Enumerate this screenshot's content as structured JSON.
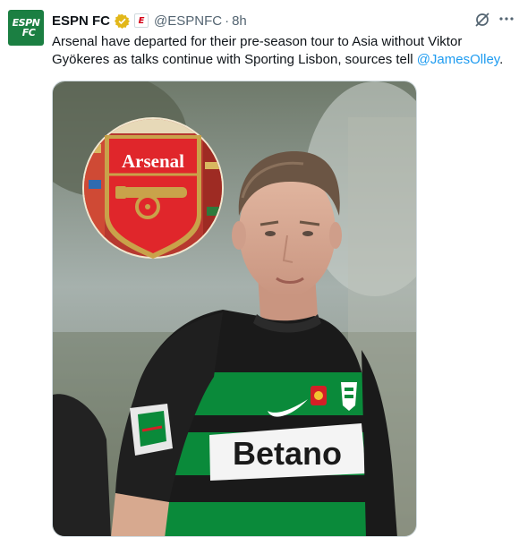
{
  "account": {
    "avatar_line1": "ESPN",
    "avatar_line2": "FC",
    "name": "ESPN FC",
    "affiliate_badge": "E",
    "handle": "@ESPNFC",
    "separator": "·",
    "time": "8h",
    "verified_icon": "verified-badge-icon",
    "grok_icon": "grok-icon",
    "more_icon": "more-options-icon"
  },
  "tweet": {
    "text_before": "Arsenal have departed for their pre-season tour to Asia without Viktor Gyökeres as talks continue with Sporting Lisbon, sources tell ",
    "mention": "@JamesOlley",
    "text_after": "."
  },
  "media": {
    "badge_title": "Arsenal",
    "sponsor_text": "Betano",
    "colors": {
      "arsenal_red": "#d51f26",
      "sporting_green": "#0a8a3a",
      "shirt_black": "#1a1a1a",
      "gold": "#c9a24a"
    }
  }
}
